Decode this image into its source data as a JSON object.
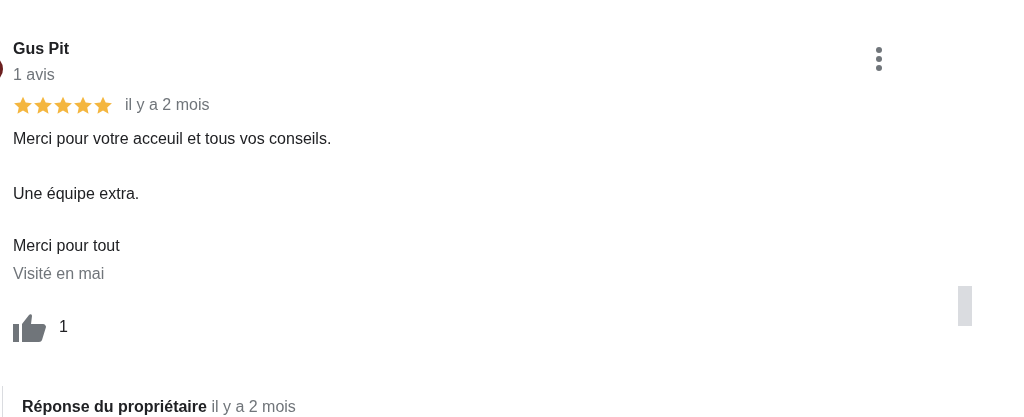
{
  "review": {
    "author": "Gus Pit",
    "review_count": "1 avis",
    "stars": 5,
    "date": "il y a 2 mois",
    "paragraphs": [
      "Merci pour votre acceuil et tous vos conseils.",
      "Une équipe extra.",
      "Merci pour tout"
    ],
    "visited": "Visité en mai",
    "likes": "1"
  },
  "owner_reply": {
    "label": "Réponse du propriétaire",
    "date": "il y a 2 mois"
  }
}
